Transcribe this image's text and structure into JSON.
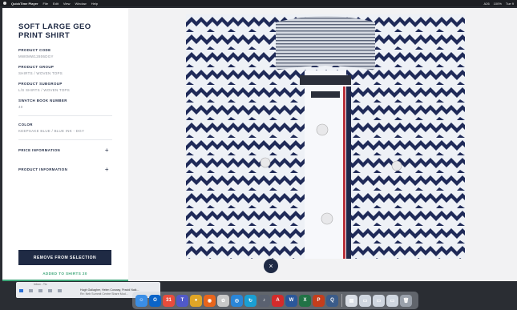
{
  "menubar": {
    "app": "QuickTime Player",
    "items": [
      "File",
      "Edit",
      "View",
      "Window",
      "Help"
    ],
    "right": [
      "A26",
      "100%",
      "Tue 9"
    ]
  },
  "product": {
    "title": "SOFT LARGE GEO PRINT SHIRT",
    "fields": [
      {
        "label": "PRODUCT CODE",
        "value": "MW0MW12806DGY"
      },
      {
        "label": "PRODUCT GROUP",
        "value": "SHIRTS / WOVEN TOPS"
      },
      {
        "label": "PRODUCT SUBGROUP",
        "value": "L/S SHIRTS / WOVEN TOPS"
      },
      {
        "label": "SWATCH BOOK NUMBER",
        "value": "40"
      }
    ],
    "color": {
      "label": "COLOR",
      "value": "KEEPSAKE BLUE / BLUE INK - DGY"
    },
    "accordions": [
      {
        "label": "PRICE INFORMATION",
        "icon": "+"
      },
      {
        "label": "PRODUCT INFORMATION",
        "icon": "+"
      }
    ],
    "remove_label": "REMOVE FROM SELECTION",
    "added_label": "ADDED TO SHIRTS 20"
  },
  "viewer": {
    "close_icon": "×",
    "colors": {
      "navy": "#1f2a44",
      "green": "#3fa77a"
    }
  },
  "mail_preview": {
    "line1": "Inbox - Tic",
    "line2": "Hugh Gallagher, Helen Conway, Pravid Naik...",
    "line3": "Re: Neb Summit Centre Share Mod..."
  },
  "dock": {
    "apps": [
      {
        "name": "finder-icon",
        "color": "#3a8ee6",
        "glyph": "☺"
      },
      {
        "name": "outlook-icon",
        "color": "#0a64c8",
        "glyph": "O"
      },
      {
        "name": "calendar-icon",
        "color": "#e74c3c",
        "glyph": "31"
      },
      {
        "name": "teams-icon",
        "color": "#5059c9",
        "glyph": "T"
      },
      {
        "name": "chrome-icon",
        "color": "#e0a526",
        "glyph": "●"
      },
      {
        "name": "firefox-icon",
        "color": "#e8651c",
        "glyph": "◉"
      },
      {
        "name": "photos-icon",
        "color": "#c8c8c8",
        "glyph": "✿"
      },
      {
        "name": "safari-icon",
        "color": "#2a86d8",
        "glyph": "◎"
      },
      {
        "name": "sync-icon",
        "color": "#1a9fd3",
        "glyph": "↻"
      },
      {
        "name": "music-icon",
        "color": "#5a6170",
        "glyph": "♪"
      },
      {
        "name": "acrobat-icon",
        "color": "#d32b2b",
        "glyph": "A"
      },
      {
        "name": "word-icon",
        "color": "#2b579a",
        "glyph": "W"
      },
      {
        "name": "excel-icon",
        "color": "#217346",
        "glyph": "X"
      },
      {
        "name": "powerpoint-icon",
        "color": "#c43e1c",
        "glyph": "P"
      },
      {
        "name": "quicktime-icon",
        "color": "#3b5c8a",
        "glyph": "Q"
      },
      {
        "name": "preview-icon",
        "color": "#d8dde5",
        "glyph": "▤"
      },
      {
        "name": "folder-icon",
        "color": "#cfd6e0",
        "glyph": "▭"
      },
      {
        "name": "downloads-icon",
        "color": "#cfd6e0",
        "glyph": "▭"
      },
      {
        "name": "doc-icon",
        "color": "#cfd6e0",
        "glyph": "▭"
      },
      {
        "name": "trash-icon",
        "color": "#9aa1ab",
        "glyph": "🗑"
      }
    ]
  }
}
